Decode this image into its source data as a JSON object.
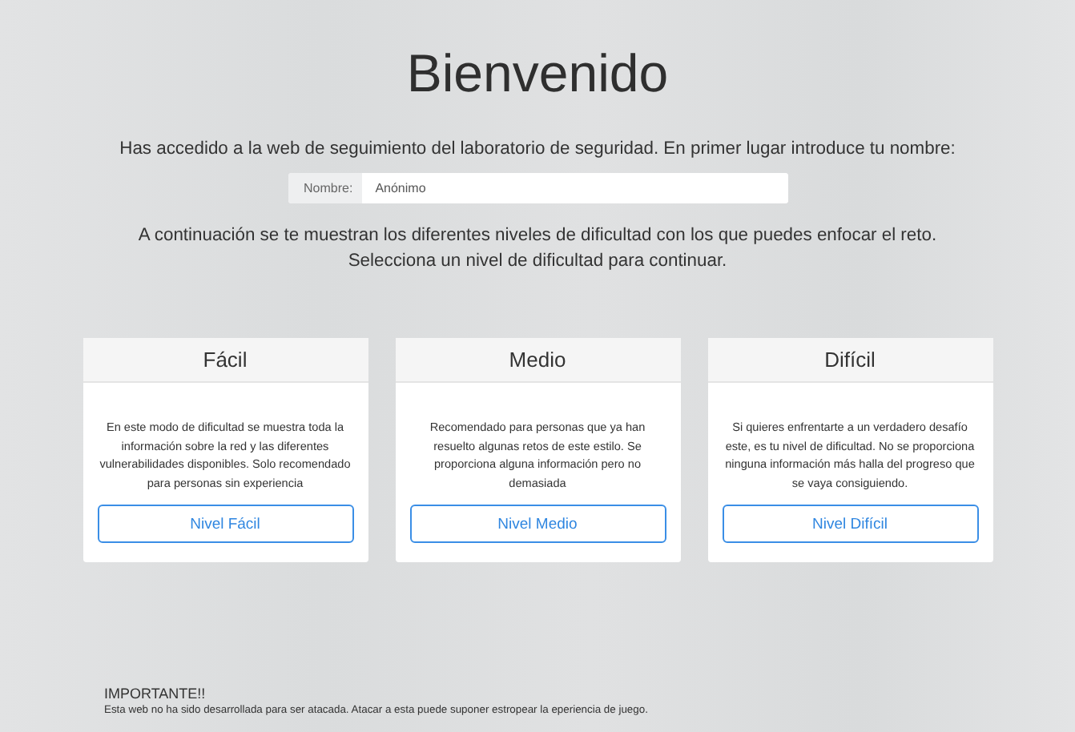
{
  "title": "Bienvenido",
  "intro": "Has accedido a la web de seguimiento del laboratorio de seguridad. En primer lugar introduce tu nombre:",
  "name_field": {
    "label": "Nombre:",
    "value": "Anónimo"
  },
  "instructions": [
    "A continuación se te muestran los diferentes niveles de dificultad con los que puedes enfocar el reto.",
    "Selecciona un nivel de dificultad para continuar."
  ],
  "levels": [
    {
      "title": "Fácil",
      "description": "En este modo de dificultad se muestra toda la información sobre la red y las diferentes vulnerabilidades disponibles. Solo recomendado para personas sin experiencia",
      "button": "Nivel Fácil"
    },
    {
      "title": "Medio",
      "description": "Recomendado para personas que ya han resuelto algunas retos de este estilo. Se proporciona alguna información pero no demasiada",
      "button": "Nivel Medio"
    },
    {
      "title": "Difícil",
      "description": "Si quieres enfrentarte a un verdadero desafío este, es tu nivel de dificultad. No se proporciona ninguna información más halla del progreso que se vaya consiguiendo.",
      "button": "Nivel Difícil"
    }
  ],
  "notice": {
    "heading": "IMPORTANTE!!",
    "text": "Esta web no ha sido desarrollada para ser atacada. Atacar a esta puede suponer estropear la eperiencia de juego."
  }
}
